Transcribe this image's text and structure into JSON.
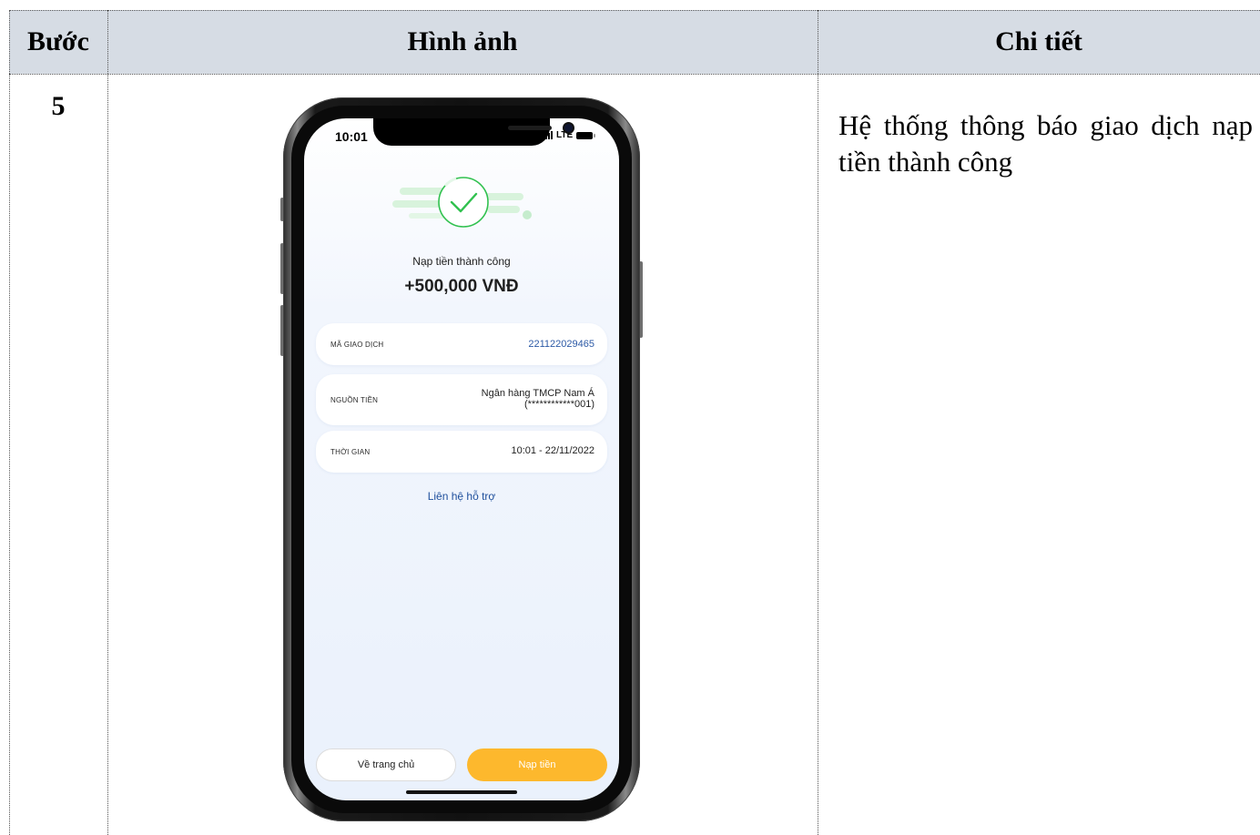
{
  "table": {
    "headers": {
      "step": "Bước",
      "image": "Hình ảnh",
      "detail": "Chi tiết"
    },
    "row": {
      "step": "5",
      "detail": "Hệ thống thông báo giao dịch nạp tiền thành công"
    }
  },
  "phone": {
    "status_bar": {
      "time": "10:01",
      "network": "LTE"
    },
    "success": {
      "title": "Nạp tiền thành công",
      "amount": "+500,000 VNĐ"
    },
    "details": [
      {
        "label": "MÃ GIAO DỊCH",
        "value": "221122029465"
      },
      {
        "label": "NGUỒN TIỀN",
        "value_line1": "Ngân hàng TMCP Nam Á",
        "value_line2": "(************001)"
      },
      {
        "label": "THỜI GIAN",
        "value": "10:01 - 22/11/2022"
      }
    ],
    "support_link": "Liên hệ hỗ trợ",
    "buttons": {
      "home": "Về trang chủ",
      "topup": "Nạp tiền"
    },
    "colors": {
      "accent": "#fdb82d",
      "success": "#31c14f",
      "link": "#2d5aa6"
    }
  }
}
